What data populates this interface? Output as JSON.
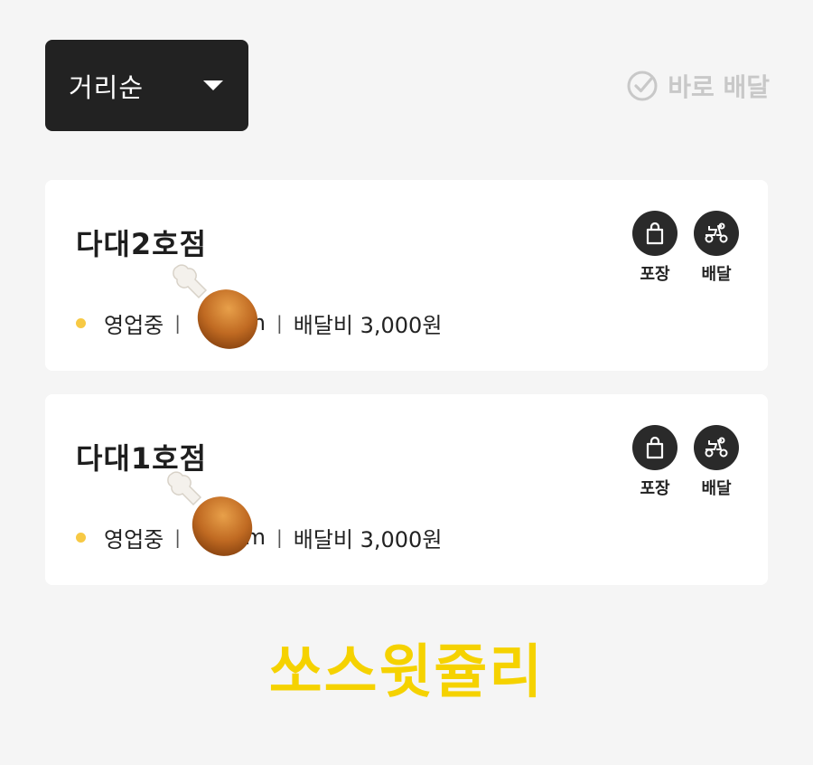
{
  "sort": {
    "label": "거리순"
  },
  "filter": {
    "instant_delivery_label": "바로 배달"
  },
  "stores": [
    {
      "name": "다대2호점",
      "status": "영업중",
      "distance_suffix": "m",
      "delivery_fee": "배달비 3,000원",
      "services": [
        "포장",
        "배달"
      ]
    },
    {
      "name": "다대1호점",
      "status": "영업중",
      "distance_suffix": "m",
      "delivery_fee": "배달비 3,000원",
      "services": [
        "포장",
        "배달"
      ]
    }
  ],
  "watermark": "쏘스윗쥴리",
  "colors": {
    "status_open": "#f7c944",
    "watermark": "#f5d200",
    "dropdown_bg": "#222222",
    "service_icon_bg": "#2a2a2a"
  },
  "icons": {
    "status": "status-dot",
    "instant_delivery": "check-circle-icon",
    "takeout": "shopping-bag-icon",
    "delivery": "scooter-icon",
    "sticker": "chicken-drumstick-icon"
  }
}
